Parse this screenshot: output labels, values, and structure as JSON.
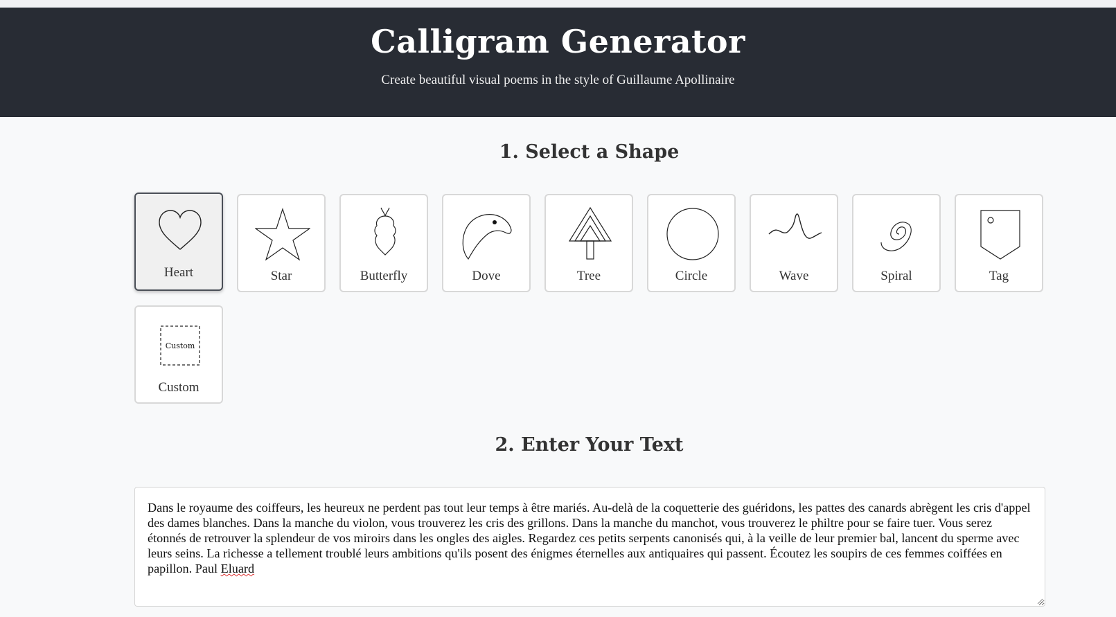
{
  "header": {
    "title": "Calligram Generator",
    "subtitle": "Create beautiful visual poems in the style of Guillaume Apollinaire"
  },
  "sections": {
    "shape_title": "1. Select a Shape",
    "text_title": "2. Enter Your Text"
  },
  "shapes": [
    {
      "label": "Heart",
      "icon": "heart-icon",
      "selected": true
    },
    {
      "label": "Star",
      "icon": "star-icon",
      "selected": false
    },
    {
      "label": "Butterfly",
      "icon": "butterfly-icon",
      "selected": false
    },
    {
      "label": "Dove",
      "icon": "dove-icon",
      "selected": false
    },
    {
      "label": "Tree",
      "icon": "tree-icon",
      "selected": false
    },
    {
      "label": "Circle",
      "icon": "circle-icon",
      "selected": false
    },
    {
      "label": "Wave",
      "icon": "wave-icon",
      "selected": false
    },
    {
      "label": "Spiral",
      "icon": "spiral-icon",
      "selected": false
    },
    {
      "label": "Tag",
      "icon": "tag-icon",
      "selected": false
    },
    {
      "label": "Custom",
      "icon": "custom-icon",
      "icon_text": "Custom",
      "selected": false
    }
  ],
  "poem": {
    "text_main": "Dans le royaume des coiffeurs, les heureux ne perdent pas tout leur temps à être mariés. Au-delà de la coquetterie des guéridons, les pattes des canards abrègent les cris d'appel des dames blanches. Dans la manche du violon, vous trouverez les cris des grillons. Dans la manche du manchot, vous trouverez le philtre pour se faire tuer. Vous serez étonnés de retrouver la splendeur de vos miroirs dans les ongles des aigles. Regardez ces petits serpents canonisés qui, à la veille de leur premier bal, lancent du sperme avec leurs seins. La richesse a tellement troublé leurs ambitions qu'ils posent des énigmes éternelles aux antiquaires qui passent. Écoutez les soupirs de ces femmes coiffées en papillon. Paul ",
    "text_misspelled": "Eluard"
  },
  "colors": {
    "header_bg": "#282c34",
    "page_bg": "#f8f9fa",
    "selected_border": "#4a4f57"
  }
}
